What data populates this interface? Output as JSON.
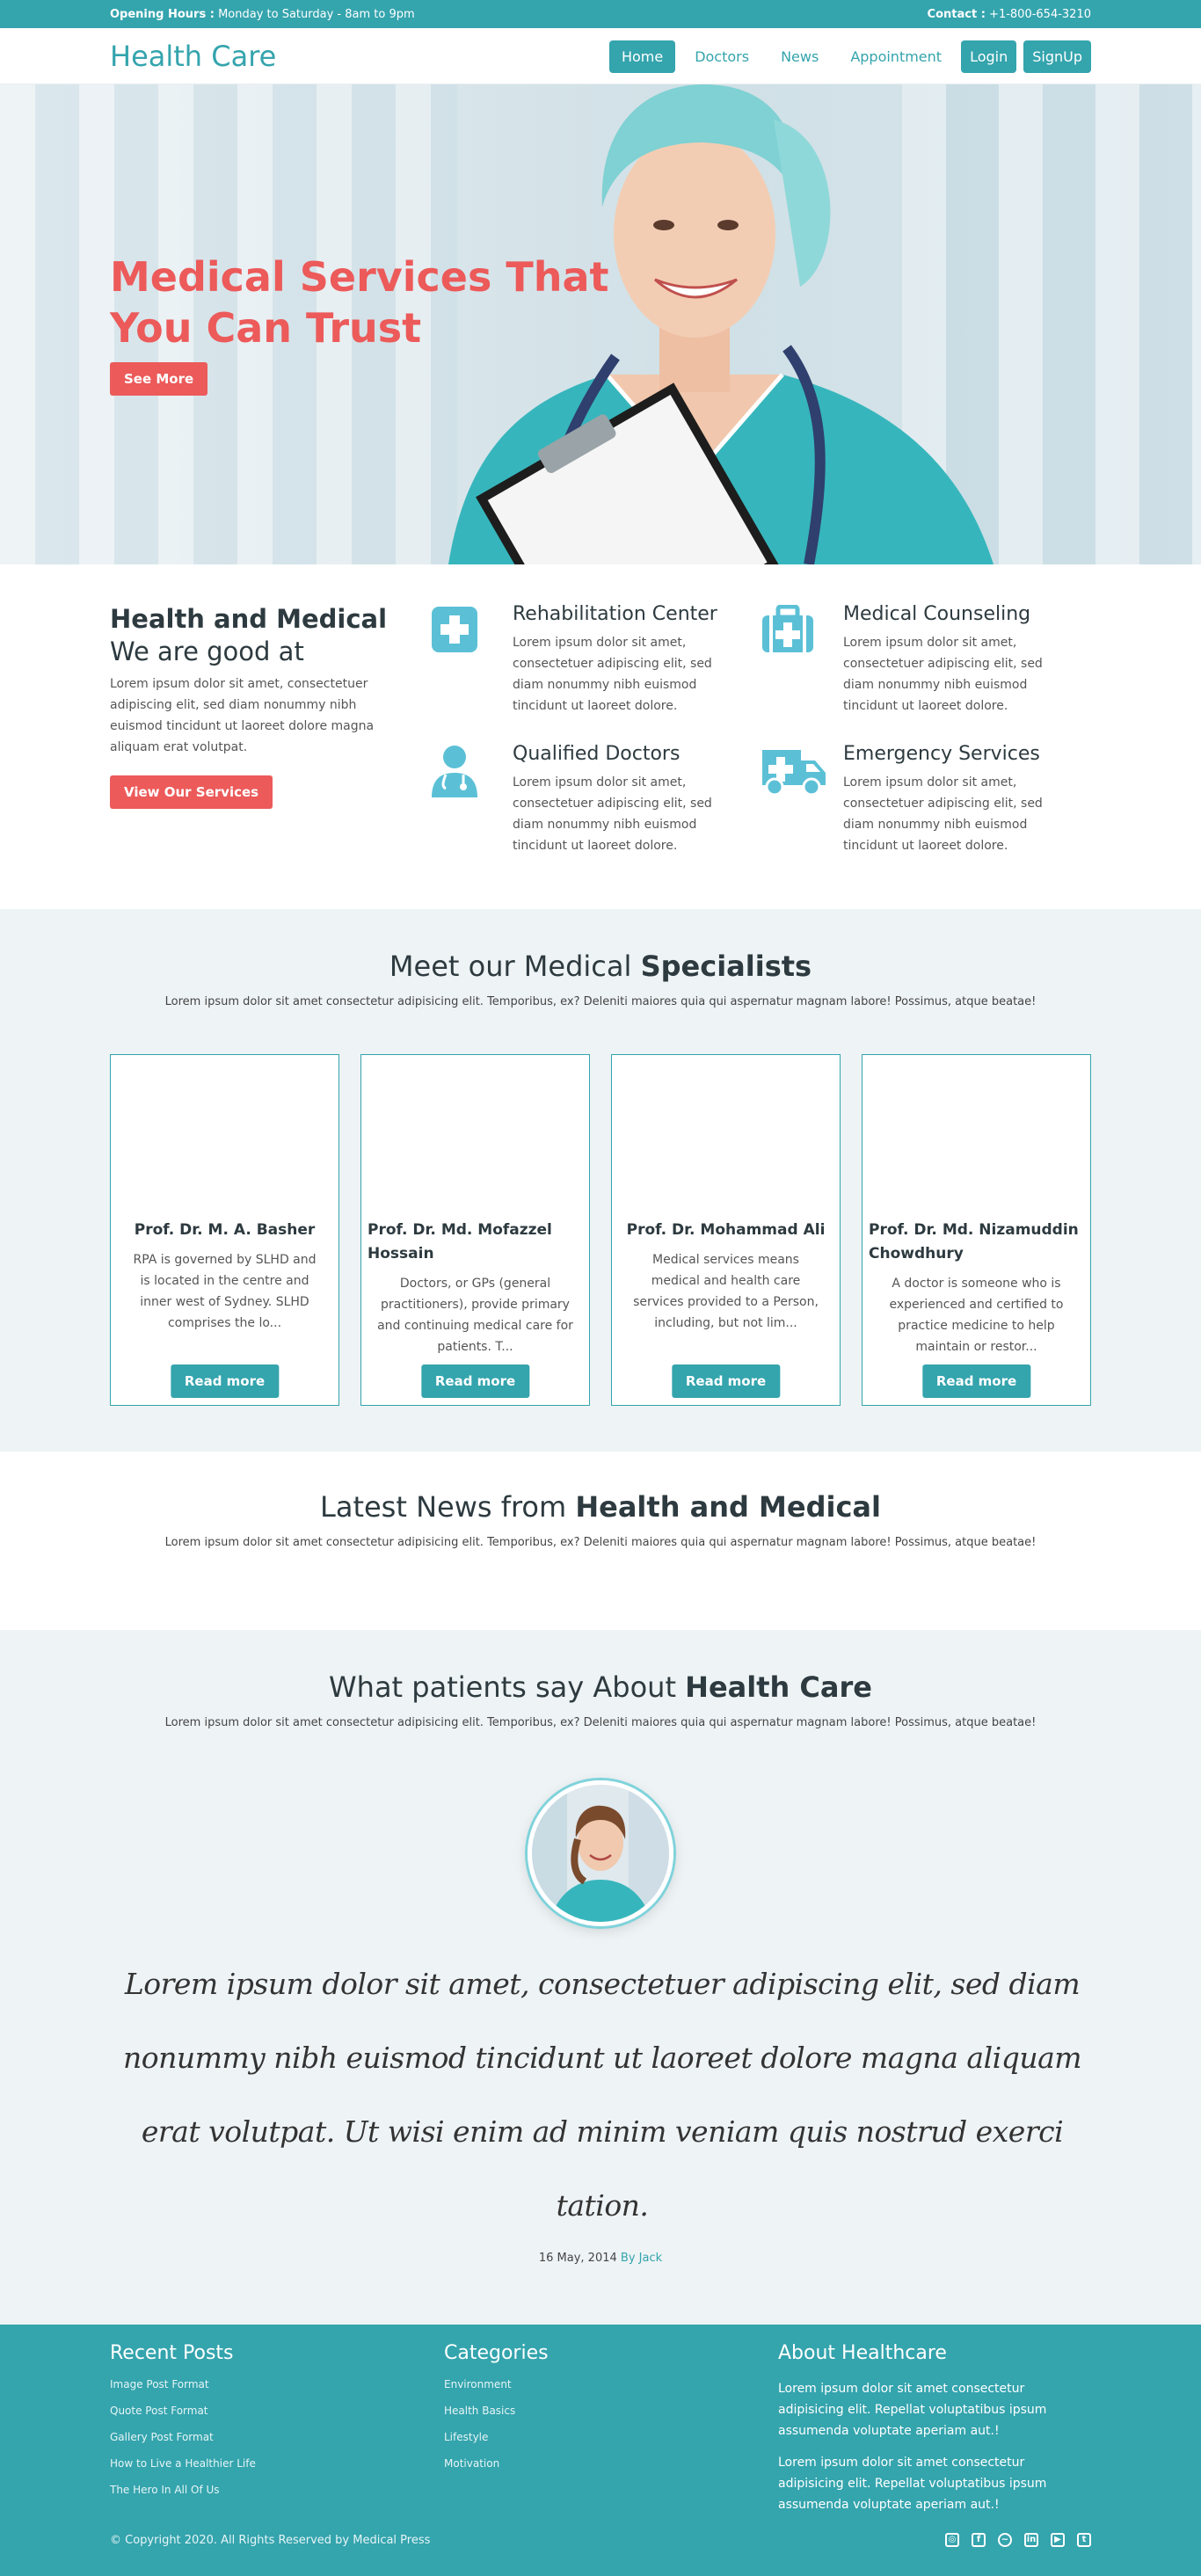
{
  "topbar": {
    "hours_label": "Opening Hours :",
    "hours_value": "Monday to Saturday - 8am to 9pm",
    "contact_label": "Contact :",
    "contact_value": "+1-800-654-3210"
  },
  "nav": {
    "brand": "Health Care",
    "items": [
      "Home",
      "Doctors",
      "News",
      "Appointment"
    ],
    "login": "Login",
    "signup": "SignUp"
  },
  "hero": {
    "title_line1": "Medical Services That",
    "title_line2": "You Can Trust",
    "button": "See More"
  },
  "services": {
    "heading_bold": "Health and Medical",
    "heading_rest": "We are good at",
    "intro": "Lorem ipsum dolor sit amet, consectetuer adipiscing elit, sed diam nonummy nibh euismod tincidunt ut laoreet dolore magna aliquam erat volutpat.",
    "button": "View Our Services",
    "items": [
      {
        "title": "Rehabilitation Center",
        "text": "Lorem ipsum dolor sit amet, consectetuer adipiscing elit, sed diam nonummy nibh euismod tincidunt ut laoreet dolore.",
        "icon": "medical-cross-icon"
      },
      {
        "title": "Medical Counseling",
        "text": "Lorem ipsum dolor sit amet, consectetuer adipiscing elit, sed diam nonummy nibh euismod tincidunt ut laoreet dolore.",
        "icon": "first-aid-kit-icon"
      },
      {
        "title": "Qualified Doctors",
        "text": "Lorem ipsum dolor sit amet, consectetuer adipiscing elit, sed diam nonummy nibh euismod tincidunt ut laoreet dolore.",
        "icon": "doctor-icon"
      },
      {
        "title": "Emergency Services",
        "text": "Lorem ipsum dolor sit amet, consectetuer adipiscing elit, sed diam nonummy nibh euismod tincidunt ut laoreet dolore.",
        "icon": "ambulance-icon"
      }
    ]
  },
  "specialists": {
    "title_pre": "Meet our Medical ",
    "title_bold": "Specialists",
    "subtitle": "Lorem ipsum dolor sit amet consectetur adipisicing elit. Temporibus, ex? Deleniti maiores quia qui aspernatur magnam labore! Possimus, atque beatae!",
    "cards": [
      {
        "name": "Prof. Dr. M. A. Basher",
        "text": "RPA is governed by SLHD and is located in the centre and inner west of Sydney. SLHD comprises the lo...",
        "button": "Read more"
      },
      {
        "name": "Prof. Dr. Md. Mofazzel Hossain",
        "text": "Doctors, or GPs (general practitioners), provide primary and continuing medical care for patients. T...",
        "button": "Read more"
      },
      {
        "name": "Prof. Dr. Mohammad Ali",
        "text": "Medical services means medical and health care services provided to a Person, including, but not lim...",
        "button": "Read more"
      },
      {
        "name": "Prof. Dr. Md. Nizamuddin Chowdhury",
        "text": "A doctor is someone who is experienced and certified to practice medicine to help maintain or restor...",
        "button": "Read more"
      }
    ]
  },
  "news": {
    "title_pre": "Latest News from ",
    "title_bold": "Health and Medical",
    "subtitle": "Lorem ipsum dolor sit amet consectetur adipisicing elit. Temporibus, ex? Deleniti maiores quia qui aspernatur magnam labore! Possimus, atque beatae!"
  },
  "testimonials": {
    "title_pre": "What patients say About ",
    "title_bold": "Health Care",
    "subtitle": "Lorem ipsum dolor sit amet consectetur adipisicing elit. Temporibus, ex? Deleniti maiores quia qui aspernatur magnam labore! Possimus, atque beatae!",
    "quote": "Lorem ipsum dolor sit amet, consectetuer adipiscing elit, sed diam nonummy nibh euismod tincidunt ut laoreet dolore magna aliquam erat volutpat. Ut wisi enim ad minim veniam quis nostrud exerci tation.",
    "date": "16 May, 2014",
    "author": "By Jack"
  },
  "footer": {
    "recent_title": "Recent Posts",
    "recent": [
      "Image Post Format",
      "Quote Post Format",
      "Gallery Post Format",
      "How to Live a Healthier Life",
      "The Hero In All Of Us"
    ],
    "categories_title": "Categories",
    "categories": [
      "Environment",
      "Health Basics",
      "Lifestyle",
      "Motivation"
    ],
    "about_title": "About Healthcare",
    "about_p1": "Lorem ipsum dolor sit amet consectetur adipisicing elit. Repellat voluptatibus ipsum assumenda voluptate aperiam aut.!",
    "about_p2": "Lorem ipsum dolor sit amet consectetur adipisicing elit. Repellat voluptatibus ipsum assumenda voluptate aperiam aut.!",
    "copyright": "© Copyright 2020. All Rights Reserved by Medical Press",
    "socials": [
      "instagram-icon",
      "facebook-icon",
      "messenger-icon",
      "linkedin-icon",
      "youtube-icon",
      "twitter-icon"
    ]
  },
  "colors": {
    "teal": "#34a4ad",
    "coral": "#ec5a5a",
    "light_bg": "#eef3f5"
  }
}
